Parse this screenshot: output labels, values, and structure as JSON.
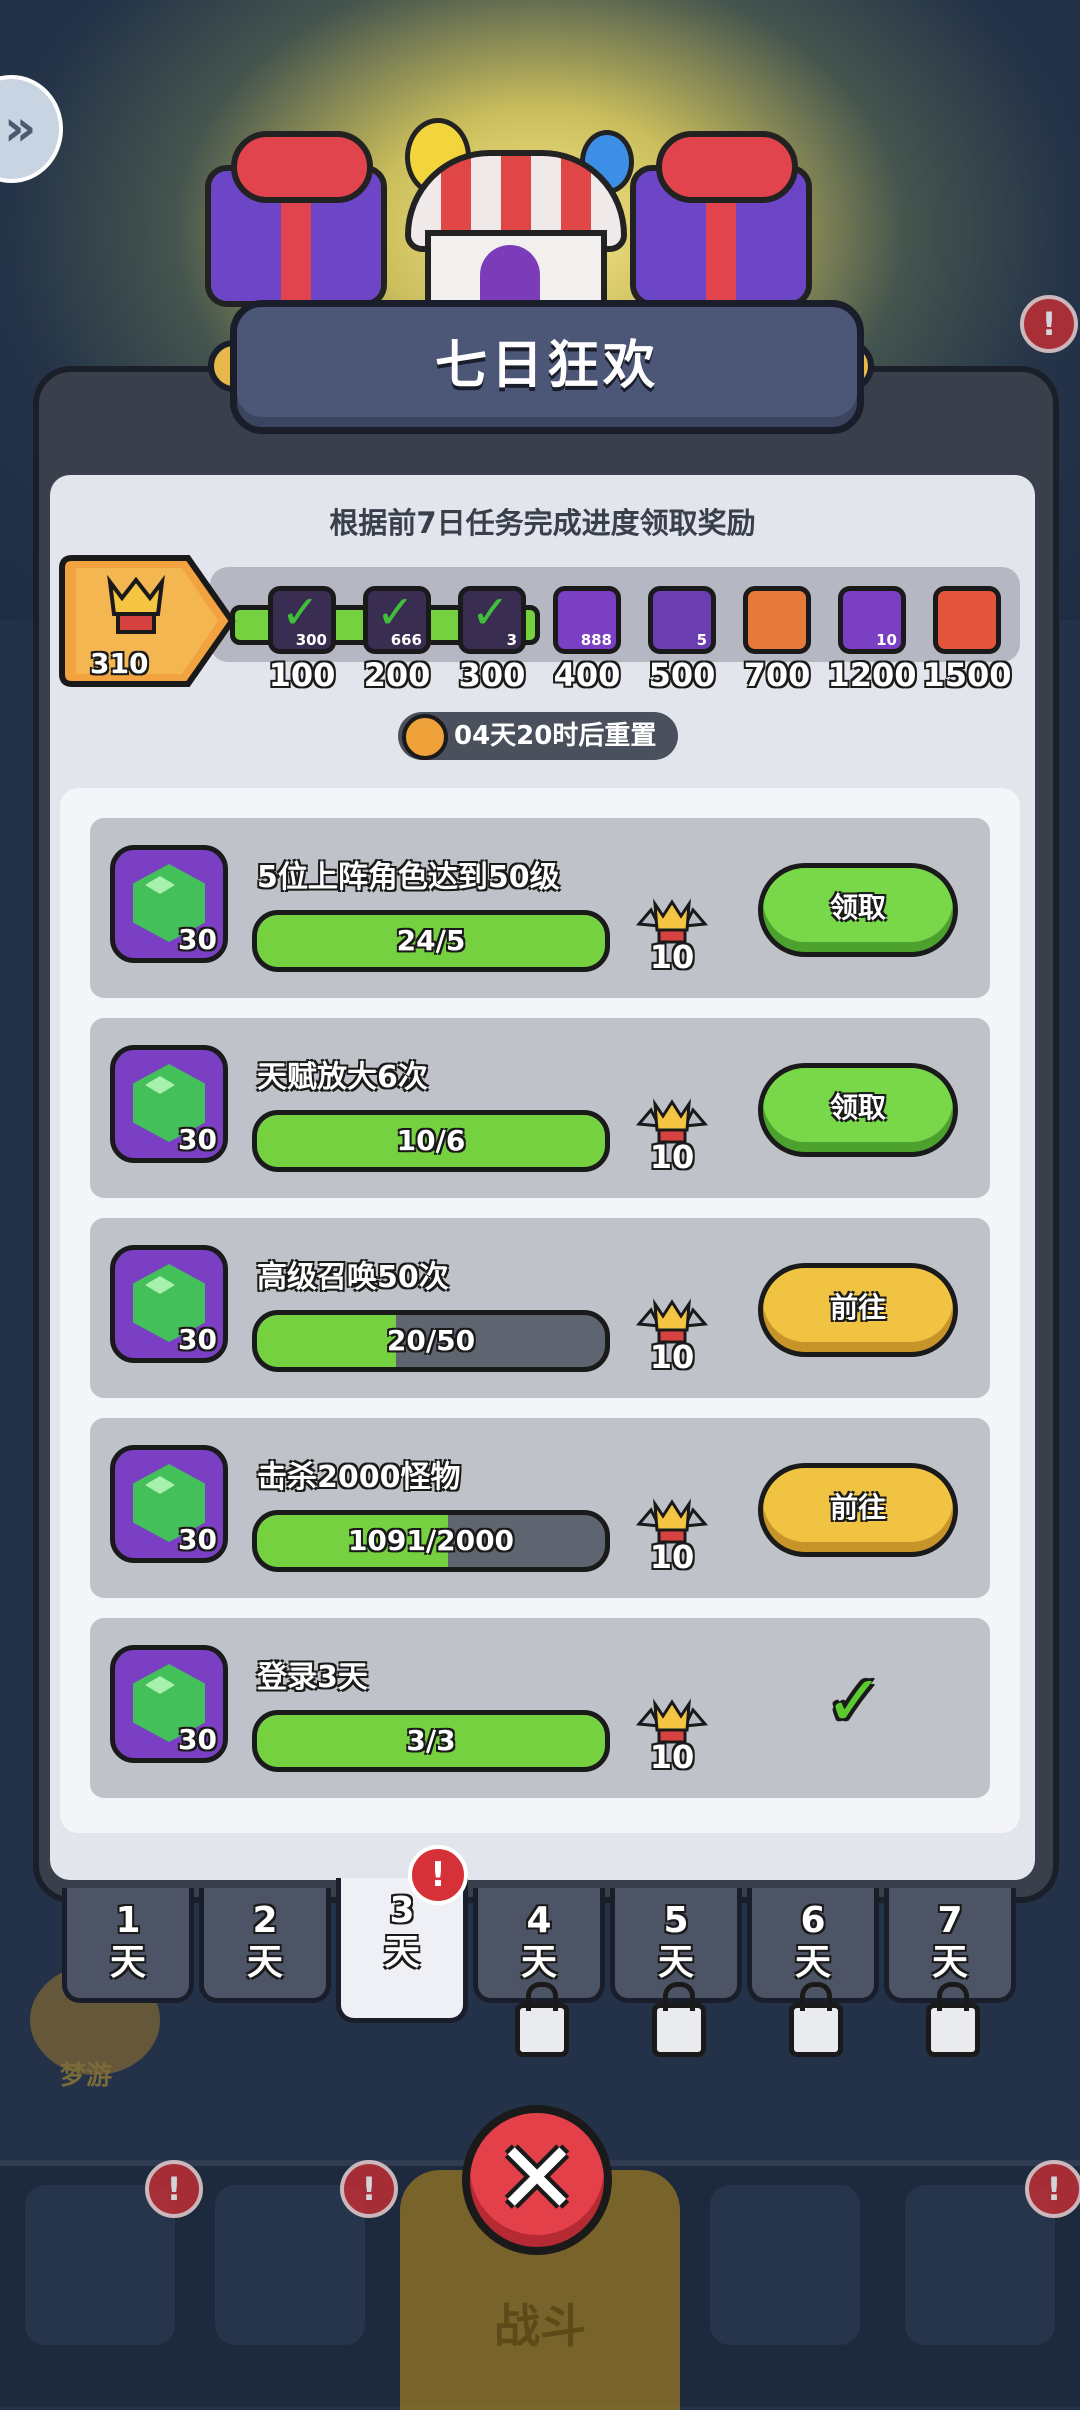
{
  "title": "七日狂欢",
  "subtitle": "根据前7日任务完成进度领取奖励",
  "points": "310",
  "milestones": [
    {
      "label": "100",
      "count": "300",
      "claimed": true
    },
    {
      "label": "200",
      "count": "666",
      "claimed": true
    },
    {
      "label": "300",
      "count": "3",
      "claimed": true
    },
    {
      "label": "400",
      "count": "888",
      "claimed": false
    },
    {
      "label": "500",
      "count": "5",
      "claimed": false
    },
    {
      "label": "700",
      "count": "",
      "claimed": false
    },
    {
      "label": "1200",
      "count": "10",
      "claimed": false
    },
    {
      "label": "1500",
      "count": "",
      "claimed": false
    }
  ],
  "timer": "04天20时后重置",
  "tasks": [
    {
      "title": "5位上阵角色达到50级",
      "progress_text": "24/5",
      "progress": 1.0,
      "gem_count": "30",
      "points": "10",
      "button": "领取",
      "state": "claim"
    },
    {
      "title": "天赋放大6次",
      "progress_text": "10/6",
      "progress": 1.0,
      "gem_count": "30",
      "points": "10",
      "button": "领取",
      "state": "claim"
    },
    {
      "title": "高级召唤50次",
      "progress_text": "20/50",
      "progress": 0.4,
      "gem_count": "30",
      "points": "10",
      "button": "前往",
      "state": "goto"
    },
    {
      "title": "击杀2000怪物",
      "progress_text": "1091/2000",
      "progress": 0.55,
      "gem_count": "30",
      "points": "10",
      "button": "前往",
      "state": "goto"
    },
    {
      "title": "登录3天",
      "progress_text": "3/3",
      "progress": 1.0,
      "gem_count": "30",
      "points": "10",
      "button": "",
      "state": "done"
    }
  ],
  "day_tabs": [
    {
      "num": "1",
      "unit": "天",
      "locked": false
    },
    {
      "num": "2",
      "unit": "天",
      "locked": false
    },
    {
      "num": "3",
      "unit": "天",
      "locked": false,
      "active": true
    },
    {
      "num": "4",
      "unit": "天",
      "locked": true
    },
    {
      "num": "5",
      "unit": "天",
      "locked": true
    },
    {
      "num": "6",
      "unit": "天",
      "locked": true
    },
    {
      "num": "7",
      "unit": "天",
      "locked": true
    }
  ],
  "tab_alert": "!",
  "bottom_nav": {
    "battle_label": "战斗",
    "sleep_label": "梦游"
  },
  "colors": {
    "accent_green": "#76d140",
    "accent_yellow": "#f0c342",
    "panel": "#3a3f4c",
    "gem_box": "#7b3fc3"
  },
  "icons": {
    "close": "close-icon",
    "check": "check-icon",
    "crown": "crown-medal-icon",
    "gem": "emerald-gem-icon",
    "lock": "lock-icon",
    "clock": "clock-icon"
  }
}
